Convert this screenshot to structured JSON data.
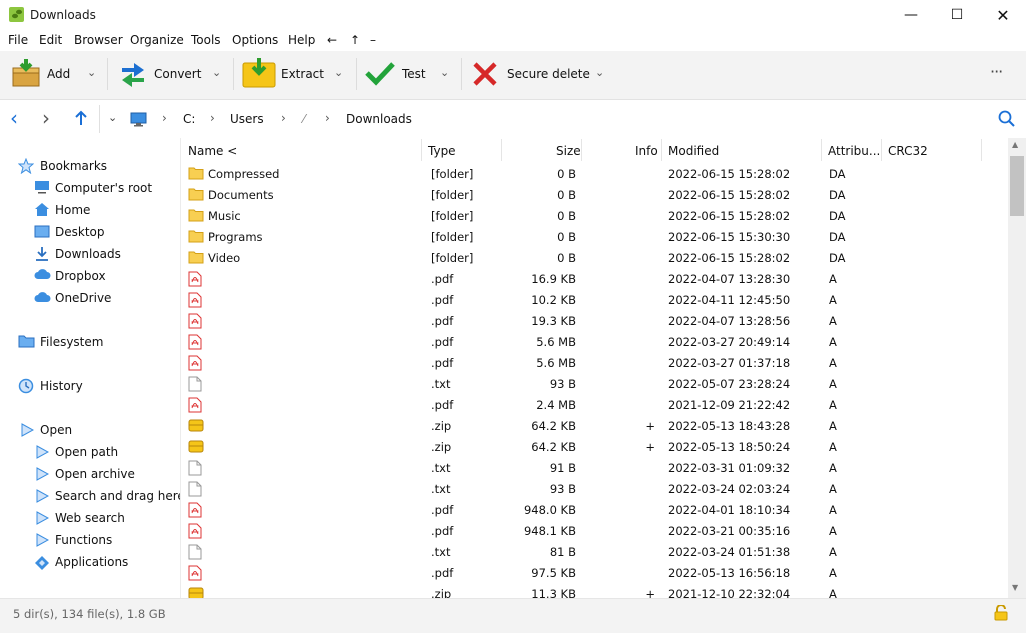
{
  "window": {
    "title": "Downloads"
  },
  "menu": [
    "File",
    "Edit",
    "Browser",
    "Organize",
    "Tools",
    "Options",
    "Help",
    "←",
    "↑",
    "–"
  ],
  "toolbar": {
    "add": "Add",
    "convert": "Convert",
    "extract": "Extract",
    "test": "Test",
    "secure_delete": "Secure delete",
    "more": "···"
  },
  "address": {
    "crumbs": [
      "C:",
      "Users",
      "⁄",
      "Downloads"
    ]
  },
  "sidebar": {
    "bookmarks": "Bookmarks",
    "bookmark_items": [
      "Computer's root",
      "Home",
      "Desktop",
      "Downloads",
      "Dropbox",
      "OneDrive"
    ],
    "filesystem": "Filesystem",
    "history": "History",
    "open": "Open",
    "open_items": [
      "Open path",
      "Open archive",
      "Search and drag here",
      "Web search",
      "Functions",
      "Applications"
    ]
  },
  "columns": {
    "name": "Name <",
    "type": "Type",
    "size": "Size",
    "info": "Info",
    "modified": "Modified",
    "attrib": "Attribu...",
    "crc": "CRC32"
  },
  "rows": [
    {
      "name": "Compressed",
      "type": "[folder]",
      "size": "0 B",
      "info": "",
      "modified": "2022-06-15 15:28:02",
      "attrib": "DA",
      "icon": "folder"
    },
    {
      "name": "Documents",
      "type": "[folder]",
      "size": "0 B",
      "info": "",
      "modified": "2022-06-15 15:28:02",
      "attrib": "DA",
      "icon": "folder"
    },
    {
      "name": "Music",
      "type": "[folder]",
      "size": "0 B",
      "info": "",
      "modified": "2022-06-15 15:28:02",
      "attrib": "DA",
      "icon": "folder"
    },
    {
      "name": "Programs",
      "type": "[folder]",
      "size": "0 B",
      "info": "",
      "modified": "2022-06-15 15:30:30",
      "attrib": "DA",
      "icon": "folder"
    },
    {
      "name": "Video",
      "type": "[folder]",
      "size": "0 B",
      "info": "",
      "modified": "2022-06-15 15:28:02",
      "attrib": "DA",
      "icon": "folder"
    },
    {
      "name": "",
      "type": ".pdf",
      "size": "16.9 KB",
      "info": "",
      "modified": "2022-04-07 13:28:30",
      "attrib": "A",
      "icon": "pdf"
    },
    {
      "name": "",
      "type": ".pdf",
      "size": "10.2 KB",
      "info": "",
      "modified": "2022-04-11 12:45:50",
      "attrib": "A",
      "icon": "pdf"
    },
    {
      "name": "",
      "type": ".pdf",
      "size": "19.3 KB",
      "info": "",
      "modified": "2022-04-07 13:28:56",
      "attrib": "A",
      "icon": "pdf"
    },
    {
      "name": "",
      "type": ".pdf",
      "size": "5.6 MB",
      "info": "",
      "modified": "2022-03-27 20:49:14",
      "attrib": "A",
      "icon": "pdf"
    },
    {
      "name": "",
      "type": ".pdf",
      "size": "5.6 MB",
      "info": "",
      "modified": "2022-03-27 01:37:18",
      "attrib": "A",
      "icon": "pdf"
    },
    {
      "name": "",
      "type": ".txt",
      "size": "93 B",
      "info": "",
      "modified": "2022-05-07 23:28:24",
      "attrib": "A",
      "icon": "txt"
    },
    {
      "name": "",
      "type": ".pdf",
      "size": "2.4 MB",
      "info": "",
      "modified": "2021-12-09 21:22:42",
      "attrib": "A",
      "icon": "pdf"
    },
    {
      "name": "",
      "type": ".zip",
      "size": "64.2 KB",
      "info": "+",
      "modified": "2022-05-13 18:43:28",
      "attrib": "A",
      "icon": "zip"
    },
    {
      "name": "",
      "type": ".zip",
      "size": "64.2 KB",
      "info": "+",
      "modified": "2022-05-13 18:50:24",
      "attrib": "A",
      "icon": "zip"
    },
    {
      "name": "",
      "type": ".txt",
      "size": "91 B",
      "info": "",
      "modified": "2022-03-31 01:09:32",
      "attrib": "A",
      "icon": "txt"
    },
    {
      "name": "",
      "type": ".txt",
      "size": "93 B",
      "info": "",
      "modified": "2022-03-24 02:03:24",
      "attrib": "A",
      "icon": "txt"
    },
    {
      "name": "",
      "type": ".pdf",
      "size": "948.0 KB",
      "info": "",
      "modified": "2022-04-01 18:10:34",
      "attrib": "A",
      "icon": "pdf"
    },
    {
      "name": "",
      "type": ".pdf",
      "size": "948.1 KB",
      "info": "",
      "modified": "2022-03-21 00:35:16",
      "attrib": "A",
      "icon": "pdf"
    },
    {
      "name": "",
      "type": ".txt",
      "size": "81 B",
      "info": "",
      "modified": "2022-03-24 01:51:38",
      "attrib": "A",
      "icon": "txt"
    },
    {
      "name": "",
      "type": ".pdf",
      "size": "97.5 KB",
      "info": "",
      "modified": "2022-05-13 16:56:18",
      "attrib": "A",
      "icon": "pdf"
    },
    {
      "name": "",
      "type": ".zip",
      "size": "11.3 KB",
      "info": "+",
      "modified": "2021-12-10 22:32:04",
      "attrib": "A",
      "icon": "zip"
    }
  ],
  "status": "5 dir(s), 134 file(s), 1.8 GB"
}
